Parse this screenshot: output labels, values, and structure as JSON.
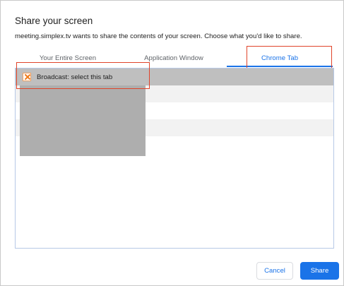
{
  "dialog": {
    "title": "Share your screen",
    "subtitle": "meeting.simplex.tv wants to share the contents of your screen. Choose what you'd like to share."
  },
  "tabs": [
    {
      "label": "Your Entire Screen",
      "selected": false
    },
    {
      "label": "Application Window",
      "selected": false
    },
    {
      "label": "Chrome Tab",
      "selected": true
    }
  ],
  "chrome_tabs": {
    "items": [
      {
        "title": "Broadcast: select this tab",
        "favicon": "close-x-icon",
        "selected": true
      }
    ]
  },
  "buttons": {
    "cancel_label": "Cancel",
    "share_label": "Share"
  },
  "colors": {
    "accent": "#1a73e8",
    "highlight_annotation": "#e0442a",
    "selected_row": "#bfbfbf"
  }
}
